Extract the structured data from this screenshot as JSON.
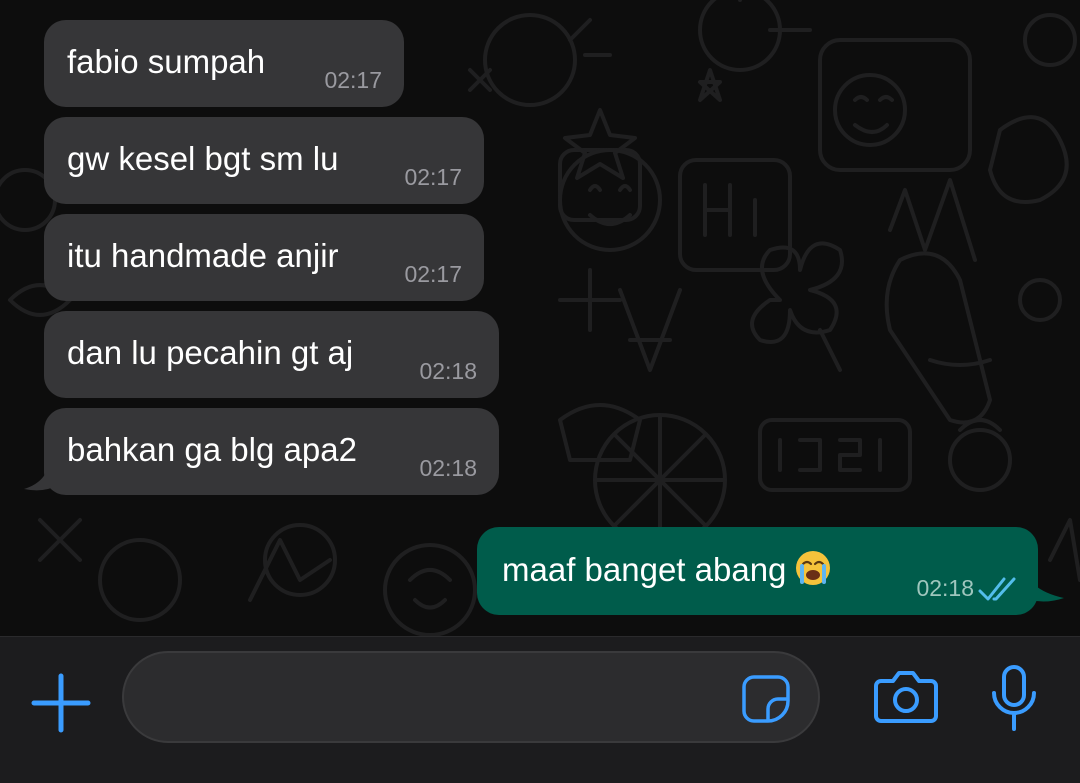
{
  "messages": [
    {
      "text": "fabio sumpah",
      "time": "02:17",
      "direction": "incoming"
    },
    {
      "text": "gw kesel bgt sm lu",
      "time": "02:17",
      "direction": "incoming"
    },
    {
      "text": "itu handmade anjir",
      "time": "02:17",
      "direction": "incoming"
    },
    {
      "text": "dan lu pecahin gt aj",
      "time": "02:18",
      "direction": "incoming"
    },
    {
      "text": "bahkan ga blg apa2",
      "time": "02:18",
      "direction": "incoming"
    },
    {
      "text": "maaf banget abang",
      "emoji": "loudly-crying-face",
      "time": "02:18",
      "direction": "outgoing",
      "status": "read"
    }
  ],
  "input_bar": {
    "placeholder": "",
    "value": "",
    "icons": [
      "plus-icon",
      "sticker-icon",
      "camera-icon",
      "microphone-icon"
    ]
  },
  "colors": {
    "incoming_bubble": "#363638",
    "outgoing_bubble": "#005c4b",
    "accent": "#3a9cff",
    "read_ticks": "#53bdeb"
  }
}
